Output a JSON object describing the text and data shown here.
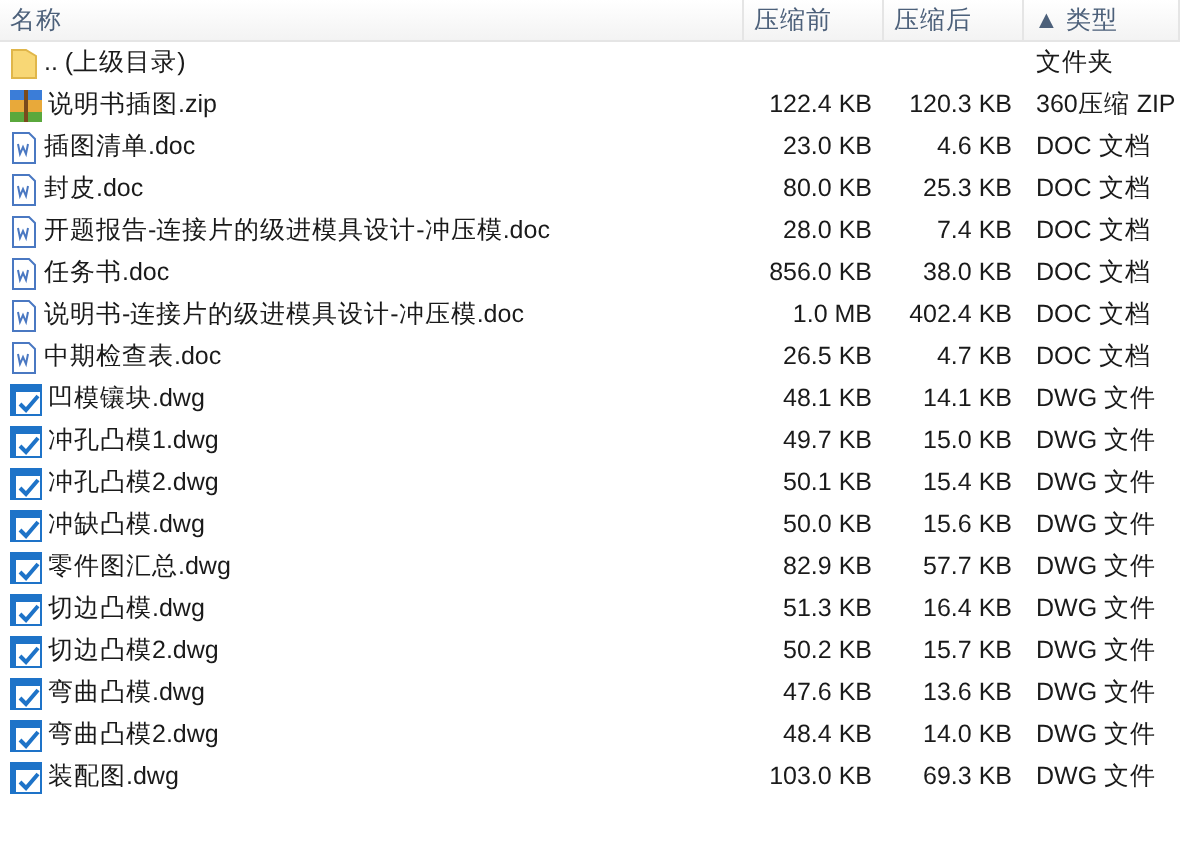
{
  "table": {
    "columns": [
      "名称",
      "压缩前",
      "压缩后",
      "▲ 类型"
    ],
    "rows": [
      {
        "kind": "folder",
        "name": ".. (上级目录)",
        "size": "",
        "packed": "",
        "type": "文件夹"
      },
      {
        "kind": "zip",
        "name": "说明书插图.zip",
        "size": "122.4 KB",
        "packed": "120.3 KB",
        "type": "360压缩 ZIP"
      },
      {
        "kind": "doc",
        "name": "插图清单.doc",
        "size": "23.0 KB",
        "packed": "4.6 KB",
        "type": "DOC 文档"
      },
      {
        "kind": "doc",
        "name": "封皮.doc",
        "size": "80.0 KB",
        "packed": "25.3 KB",
        "type": "DOC 文档"
      },
      {
        "kind": "doc",
        "name": "开题报告-连接片的级进模具设计-冲压模.doc",
        "size": "28.0 KB",
        "packed": "7.4 KB",
        "type": "DOC 文档"
      },
      {
        "kind": "doc",
        "name": "任务书.doc",
        "size": "856.0 KB",
        "packed": "38.0 KB",
        "type": "DOC 文档"
      },
      {
        "kind": "doc",
        "name": "说明书-连接片的级进模具设计-冲压模.doc",
        "size": "1.0 MB",
        "packed": "402.4 KB",
        "type": "DOC 文档"
      },
      {
        "kind": "doc",
        "name": "中期检查表.doc",
        "size": "26.5 KB",
        "packed": "4.7 KB",
        "type": "DOC 文档"
      },
      {
        "kind": "dwg",
        "name": "凹模镶块.dwg",
        "size": "48.1 KB",
        "packed": "14.1 KB",
        "type": "DWG 文件"
      },
      {
        "kind": "dwg",
        "name": "冲孔凸模1.dwg",
        "size": "49.7 KB",
        "packed": "15.0 KB",
        "type": "DWG 文件"
      },
      {
        "kind": "dwg",
        "name": "冲孔凸模2.dwg",
        "size": "50.1 KB",
        "packed": "15.4 KB",
        "type": "DWG 文件"
      },
      {
        "kind": "dwg",
        "name": "冲缺凸模.dwg",
        "size": "50.0 KB",
        "packed": "15.6 KB",
        "type": "DWG 文件"
      },
      {
        "kind": "dwg",
        "name": "零件图汇总.dwg",
        "size": "82.9 KB",
        "packed": "57.7 KB",
        "type": "DWG 文件"
      },
      {
        "kind": "dwg",
        "name": "切边凸模.dwg",
        "size": "51.3 KB",
        "packed": "16.4 KB",
        "type": "DWG 文件"
      },
      {
        "kind": "dwg",
        "name": "切边凸模2.dwg",
        "size": "50.2 KB",
        "packed": "15.7 KB",
        "type": "DWG 文件"
      },
      {
        "kind": "dwg",
        "name": "弯曲凸模.dwg",
        "size": "47.6 KB",
        "packed": "13.6 KB",
        "type": "DWG 文件"
      },
      {
        "kind": "dwg",
        "name": "弯曲凸模2.dwg",
        "size": "48.4 KB",
        "packed": "14.0 KB",
        "type": "DWG 文件"
      },
      {
        "kind": "dwg",
        "name": "装配图.dwg",
        "size": "103.0 KB",
        "packed": "69.3 KB",
        "type": "DWG 文件"
      }
    ]
  }
}
